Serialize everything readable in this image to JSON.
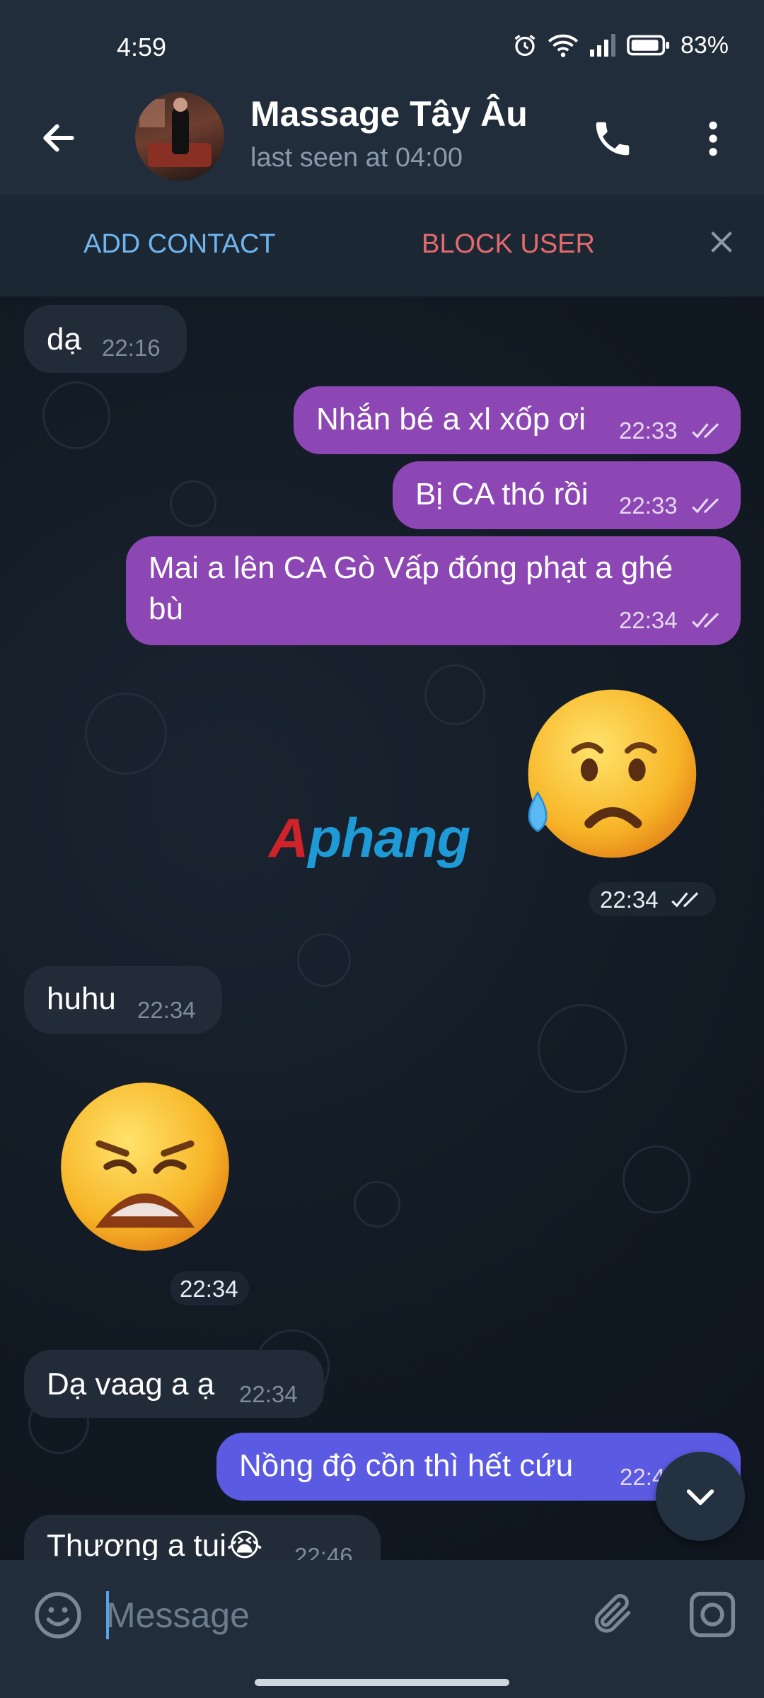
{
  "status_bar": {
    "time": "4:59",
    "battery": "83%"
  },
  "header": {
    "title": "Massage Tây Âu",
    "subtitle": "last seen at 04:00"
  },
  "action_bar": {
    "add_contact": "ADD CONTACT",
    "block_user": "BLOCK USER"
  },
  "messages": [
    {
      "text": "dạ",
      "time": "22:16"
    },
    {
      "text": "Nhắn bé a xl xốp ơi",
      "time": "22:33"
    },
    {
      "text": "Bị CA thó rồi",
      "time": "22:33"
    },
    {
      "text_line1": "Mai a lên CA Gò Vấp đóng phạt a ghé",
      "text_line2": "bù",
      "time": "22:34"
    },
    {
      "emoji": "😥",
      "time": "22:34"
    },
    {
      "text": "huhu",
      "time": "22:34"
    },
    {
      "emoji": "😩",
      "time": "22:34"
    },
    {
      "text": "Dạ vaag a ạ",
      "time": "22:34"
    },
    {
      "text": "Nồng độ cồn thì hết cứu",
      "time": "22:4"
    },
    {
      "text": "Thương a tui😭",
      "time": "22:46"
    }
  ],
  "watermark": {
    "first": "A",
    "rest": "phang"
  },
  "input": {
    "placeholder": "Message"
  },
  "colors": {
    "outgoing": "#8d47b5",
    "outgoing_alt": "#5b5ae3",
    "incoming": "#222c38",
    "header": "#212d3b",
    "accent": "#6fb5ee",
    "danger": "#e46a6d"
  }
}
